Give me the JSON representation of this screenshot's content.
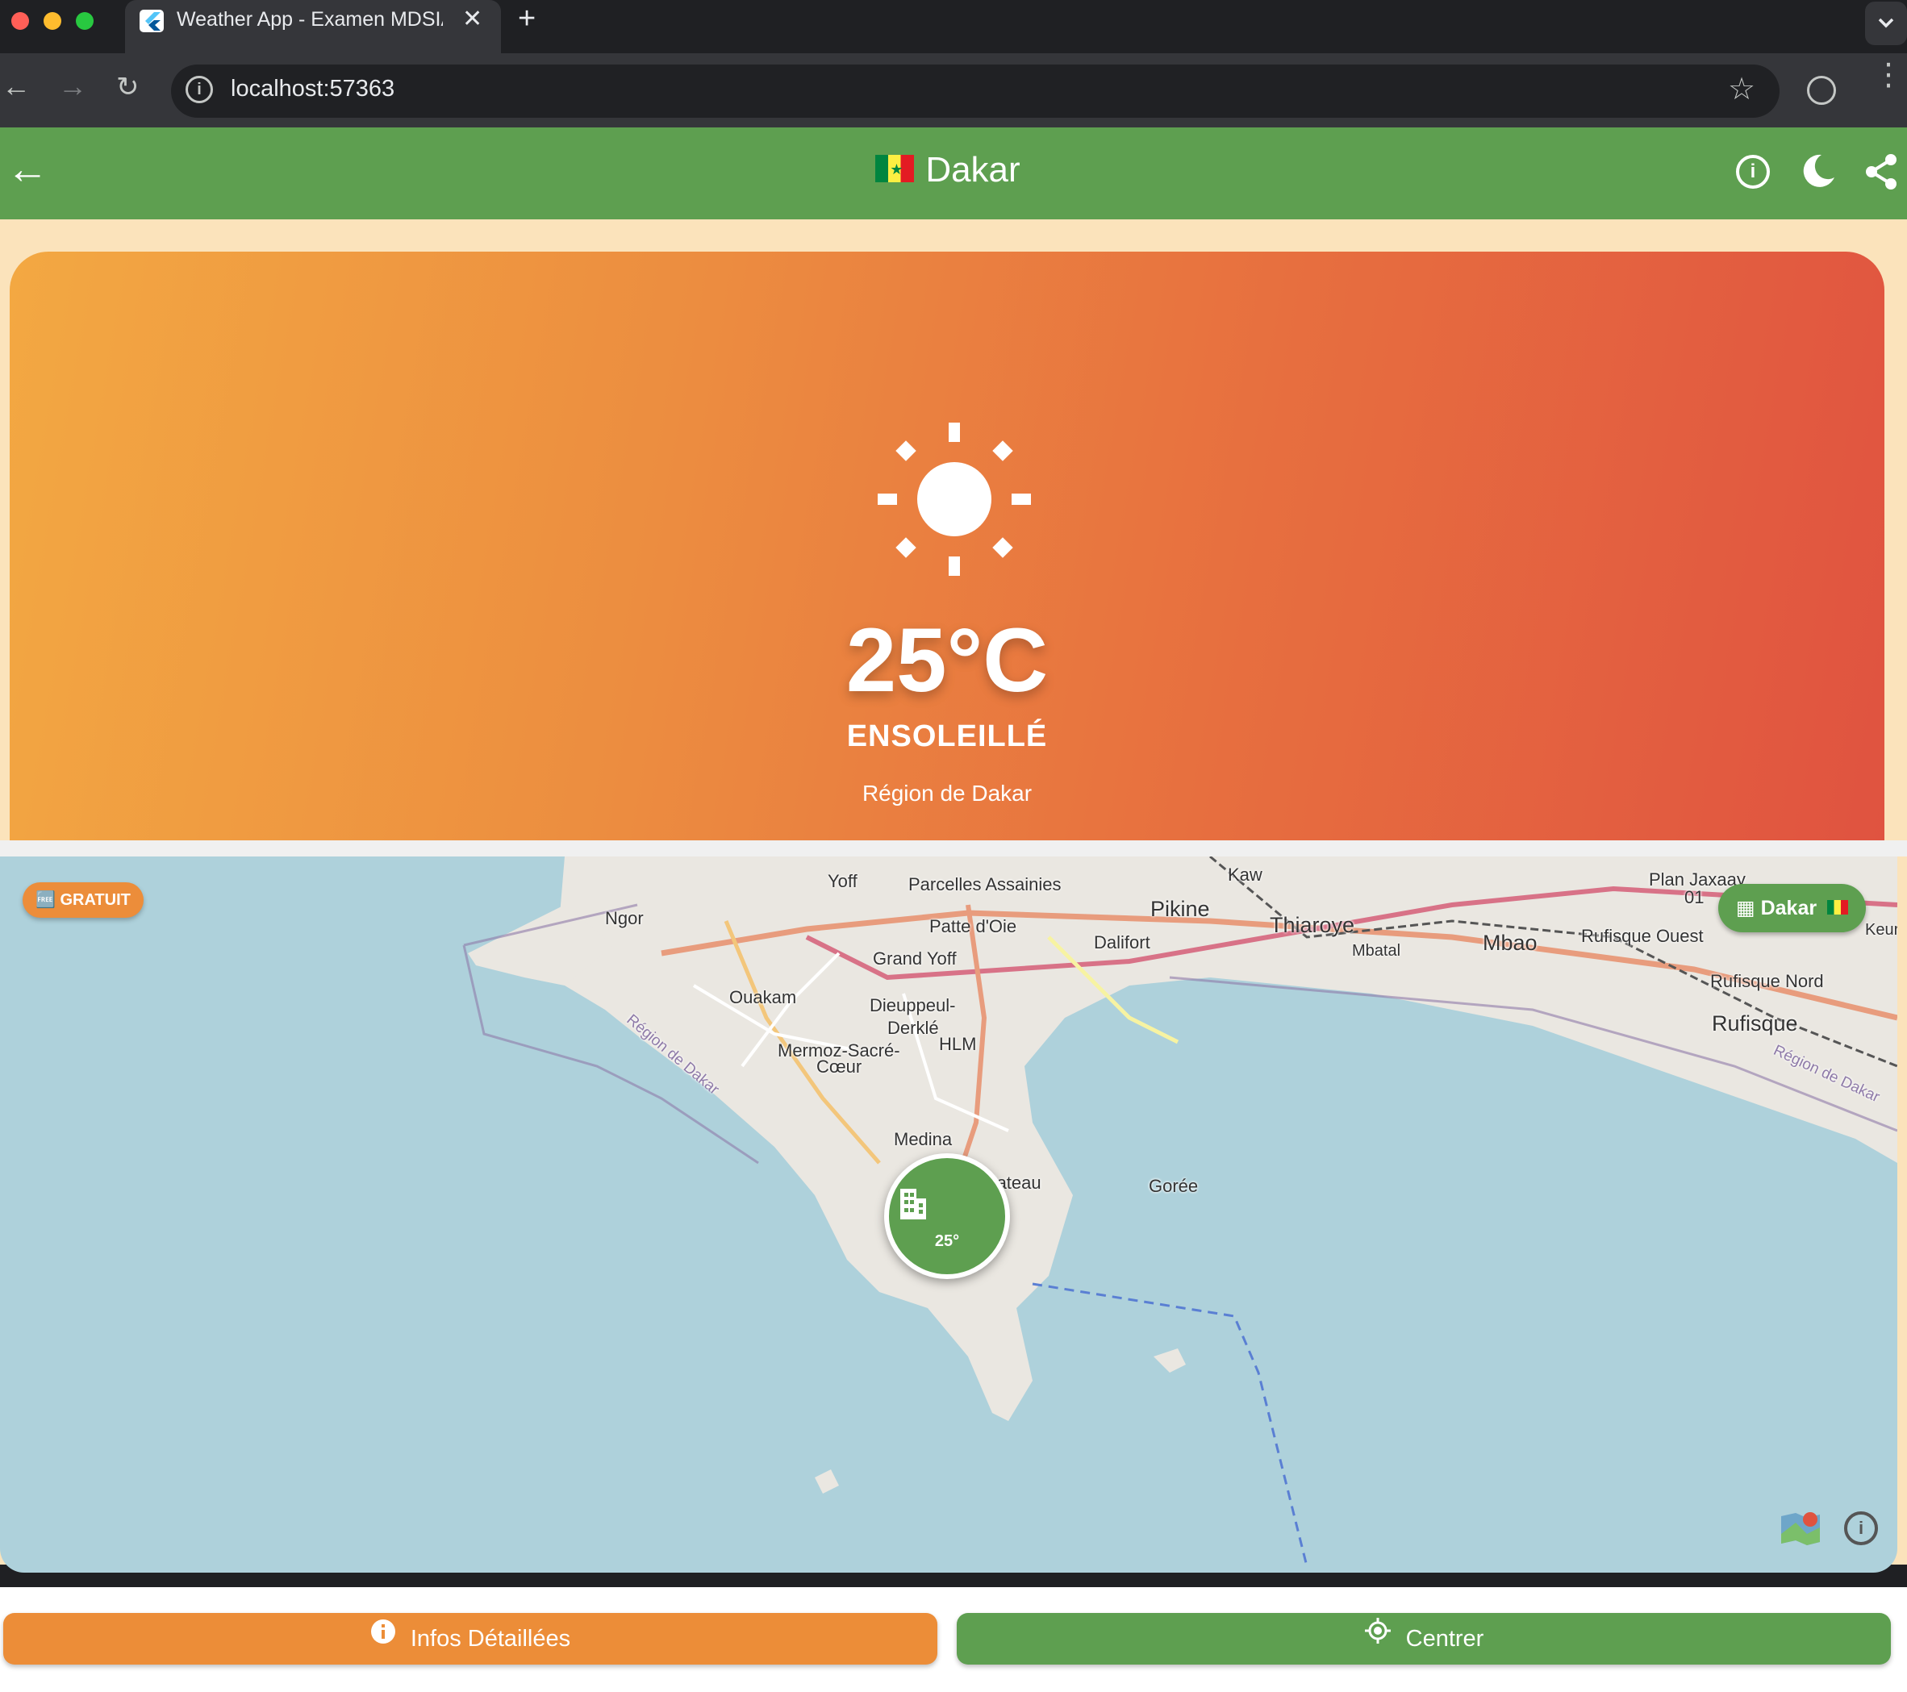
{
  "browser": {
    "tab_title": "Weather App - Examen MDSIA",
    "url": "localhost:57363"
  },
  "appbar": {
    "city": "Dakar",
    "flag_icon": "senegal-flag-icon",
    "color": "#5e9f50"
  },
  "weather": {
    "temperature": "25°C",
    "condition": "ENSOLEILLÉ",
    "region": "Région de Dakar",
    "icon": "sun-icon",
    "gradient": [
      "#f3a842",
      "#e05340"
    ]
  },
  "map": {
    "badge": "🆓 GRATUIT",
    "chip": "Dakar",
    "marker_temp": "25°",
    "labels": {
      "yoff": "Yoff",
      "parcelles": "Parcelles Assainies",
      "thiaroye_kaw": "Kaw",
      "plan_jaxaay": "Plan Jaxaay",
      "pj01": "01",
      "ngor": "Ngor",
      "patte": "Patte d'Oie",
      "pikine": "Pikine",
      "thiaroye": "Thiaroye",
      "grand_yoff": "Grand Yoff",
      "dalifort": "Dalifort",
      "mbatal": "Mbatal",
      "mbao": "Mbao",
      "rufisque_ouest": "Rufisque Ouest",
      "keur": "Keur I",
      "ouakam": "Ouakam",
      "dieuppeul": "Dieuppeul-",
      "derkle": "Derklé",
      "rufisque_nord": "Rufisque Nord",
      "rufisque": "Rufisque",
      "hlm": "HLM",
      "mermoz": "Mermoz-Sacré-",
      "coeur": "Cœur",
      "medina": "Medina",
      "plateau": "Dakar-Plateau",
      "goree": "Gorée",
      "region_w": "Région de Dakar",
      "region_e": "Région de Dakar"
    }
  },
  "buttons": {
    "info": "Infos Détaillées",
    "center": "Centrer"
  },
  "colors": {
    "orange": "#ec8d38",
    "green": "#5e9f50",
    "sea": "#aed1db"
  }
}
